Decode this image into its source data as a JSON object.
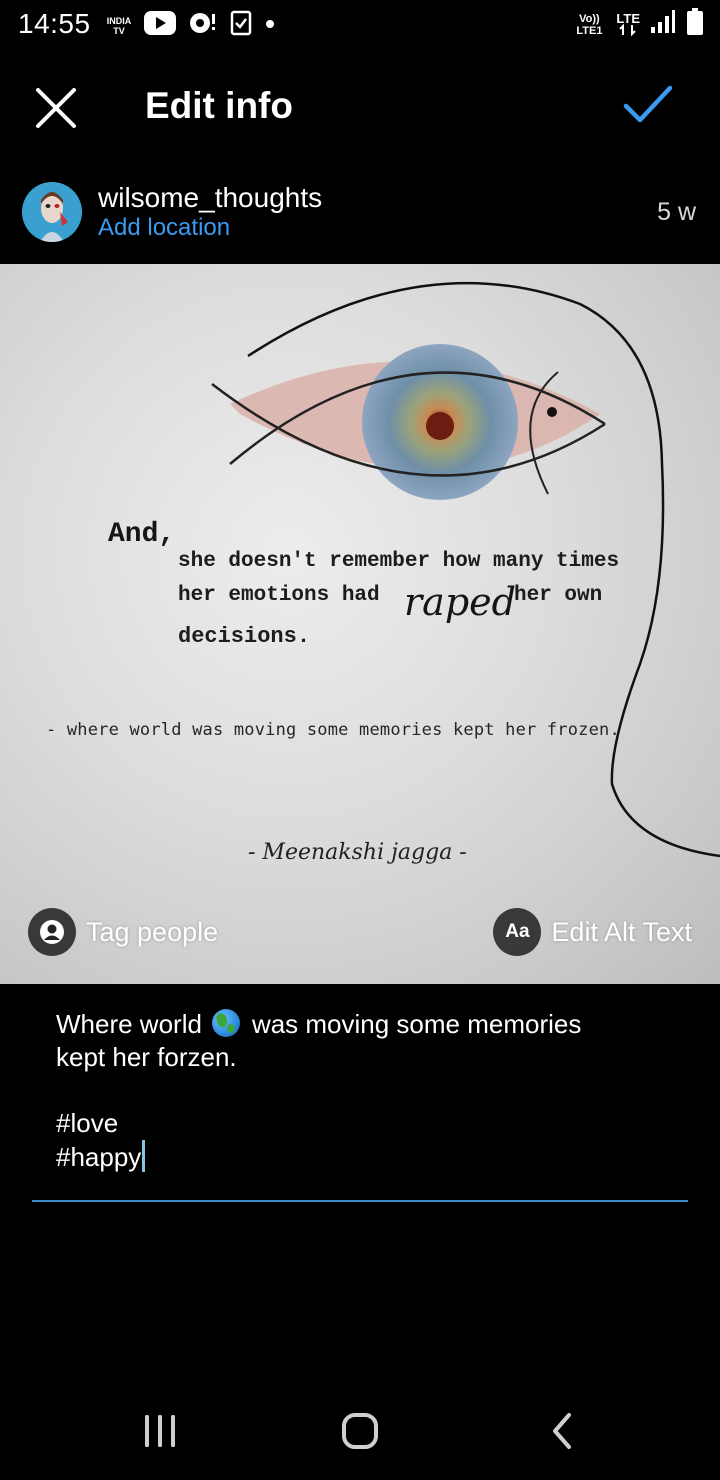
{
  "status_bar": {
    "time": "14:55",
    "india_tv_label": "INDIA TV",
    "volte_label": "Vo)) LTE1",
    "lte_label": "LTE",
    "icons": [
      "india-tv-icon",
      "youtube-icon",
      "notification-icon",
      "checkbox-icon",
      "dot-icon",
      "signal-icon",
      "battery-icon"
    ]
  },
  "header": {
    "title": "Edit info",
    "close_icon": "close-icon",
    "done_icon": "check-icon",
    "accent_color": "#3a9bf1"
  },
  "post": {
    "username": "wilsome_thoughts",
    "add_location": "Add location",
    "age": "5 w"
  },
  "image": {
    "quote_and": "And,",
    "quote_line_1": "she doesn't remember how many times",
    "quote_line_2a": "her emotions had",
    "quote_raped": "raped",
    "quote_line_2b": "her own",
    "quote_line_3": "decisions.",
    "quote_sub": "- where world was moving some memories kept her frozen.",
    "signature": "- Meenakshi jagga -",
    "tag_people": "Tag people",
    "edit_alt_text": "Edit Alt Text",
    "alt_badge": "Aa"
  },
  "caption": {
    "line_1_before": "Where world",
    "line_1_after": "was moving some memories",
    "line_2": "kept her forzen.",
    "line_3": "#love",
    "line_4": "#happy"
  },
  "nav": {
    "icons": [
      "recent-apps-icon",
      "home-icon",
      "back-icon"
    ]
  }
}
